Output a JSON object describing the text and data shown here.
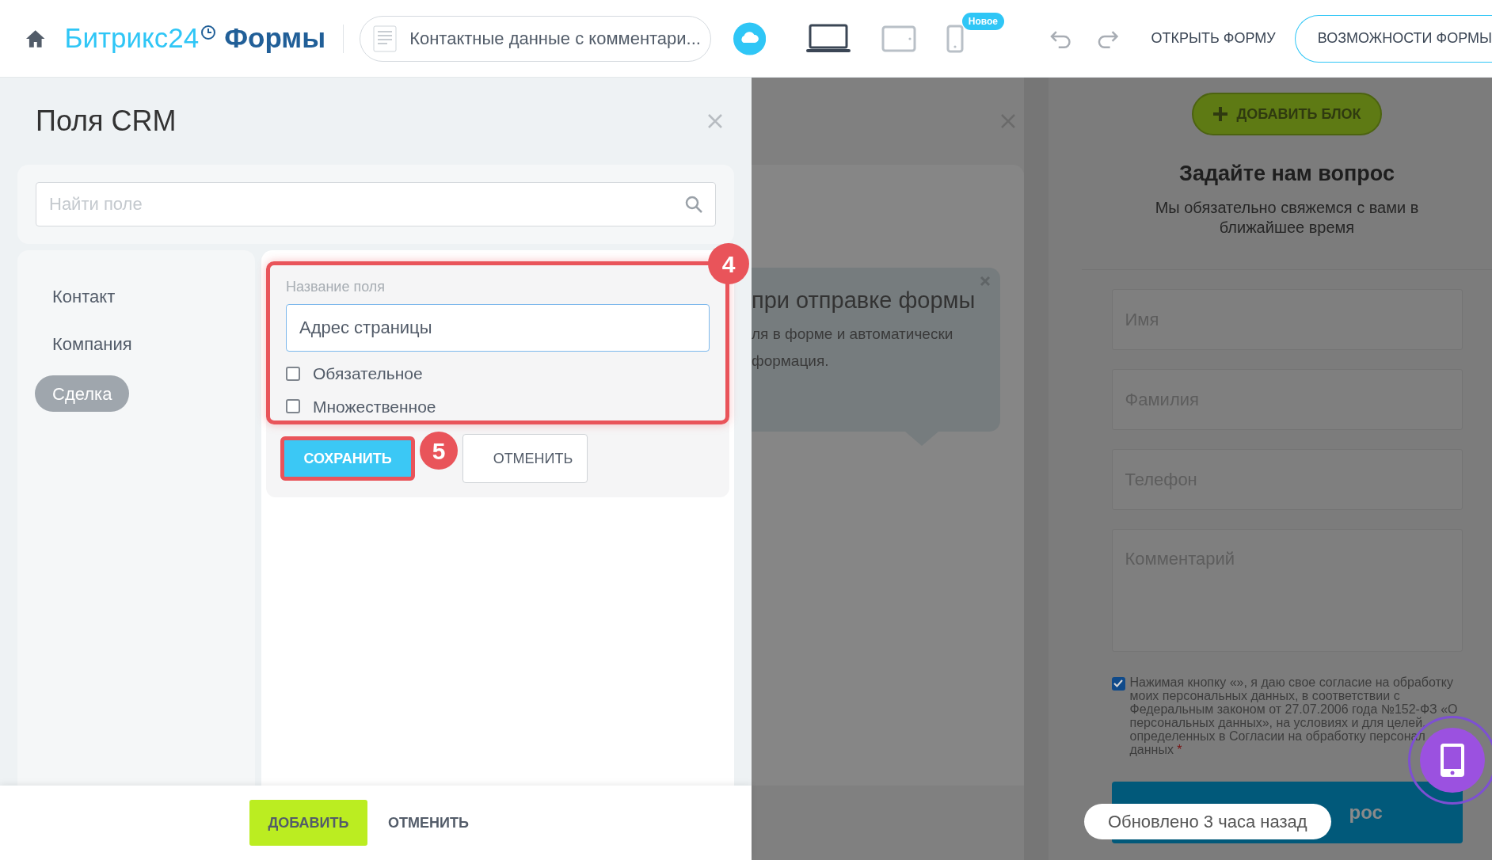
{
  "topbar": {
    "logo_brand": "Битрикс24",
    "logo_product": "Формы",
    "form_selector": "Контактные данные с комментари...",
    "devices": [
      {
        "kind": "desktop",
        "selected": true
      },
      {
        "kind": "tablet",
        "selected": false
      },
      {
        "kind": "phone",
        "selected": false
      }
    ],
    "device_badge": "Новое",
    "open_form": "ОТКРЫТЬ ФОРМУ",
    "features": "ВОЗМОЖНОСТИ ФОРМЫ"
  },
  "crm_panel": {
    "title": "Поля CRM",
    "search_placeholder": "Найти поле",
    "entities": [
      {
        "label": "Контакт",
        "selected": false
      },
      {
        "label": "Компания",
        "selected": false
      },
      {
        "label": "Сделка",
        "selected": true
      }
    ],
    "field_editor": {
      "label": "Название поля",
      "value": "Адрес страницы",
      "options": [
        {
          "label": "Обязательное",
          "checked": false
        },
        {
          "label": "Множественное",
          "checked": false
        }
      ],
      "save": "СОХРАНИТЬ",
      "cancel": "ОТМЕНИТЬ"
    },
    "annotations": [
      "4",
      "5"
    ],
    "add": "ДОБАВИТЬ",
    "cancel": "ОТМЕНИТЬ"
  },
  "background_panel": {
    "tooltip_title": "при отправке формы",
    "tooltip_lines": [
      "ля в форме и автоматически",
      "формация."
    ]
  },
  "preview": {
    "add_block": "ДОБАВИТЬ БЛОК",
    "title": "Задайте нам вопрос",
    "subtitle": "Мы обязательно свяжемся с вами в ближайшее время",
    "fields": [
      {
        "placeholder": "Имя",
        "kind": "input"
      },
      {
        "placeholder": "Фамилия",
        "kind": "input"
      },
      {
        "placeholder": "Телефон",
        "kind": "input"
      },
      {
        "placeholder": "Комментарий",
        "kind": "textarea"
      }
    ],
    "consent": {
      "checked": true,
      "text": "Нажимая кнопку «», я даю свое согласие на обработку моих персональных данных, в соответствии с Федеральным законом от 27.07.2006 года №152-ФЗ «О персональных данных», на условиях и для целей, определенных в Согласии на обработку персонал данных",
      "required_mark": "*"
    },
    "submit_text": "рос",
    "updated": "Обновлено 3 часа назад"
  }
}
